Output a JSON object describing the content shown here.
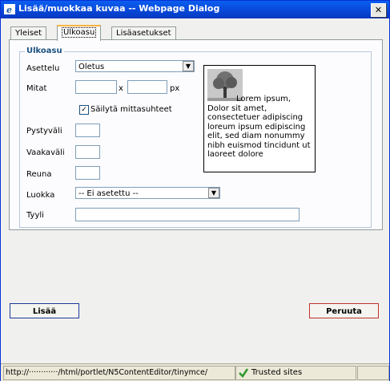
{
  "titlebar": {
    "title": "Lisää/muokkaa kuvaa -- Webpage Dialog",
    "close_glyph": "✕"
  },
  "tabs": [
    {
      "label": "Yleiset",
      "active": false
    },
    {
      "label": "Ulkoasu",
      "active": true
    },
    {
      "label": "Lisäasetukset",
      "active": false
    }
  ],
  "fieldset": {
    "legend": "Ulkoasu",
    "align_label": "Asettelu",
    "align_value": "Oletus",
    "dims_label": "Mitat",
    "width_value": "",
    "x_sep": "x",
    "height_value": "",
    "unit": "px",
    "keep_ratio_label": "Säilytä mittasuhteet",
    "keep_ratio_checked": "✓",
    "vspace_label": "Pystyväli",
    "vspace_value": "",
    "hspace_label": "Vaakaväli",
    "hspace_value": "",
    "border_label": "Reuna",
    "border_value": "",
    "class_label": "Luokka",
    "class_value": "-- Ei asetettu --",
    "style_label": "Tyyli",
    "style_value": ""
  },
  "preview": {
    "text": "Lorem ipsum, Dolor sit amet, consectetuer adipiscing loreum ipsum edipiscing elit, sed diam nonummy nibh euismod tincidunt ut laoreet dolore"
  },
  "buttons": {
    "insert": "Lisää",
    "cancel": "Peruuta"
  },
  "statusbar": {
    "url": "http://············/html/portlet/N5ContentEditor/tinymce/",
    "zone": "Trusted sites"
  },
  "colors": {
    "title_bar": "#0846d6",
    "legend": "#1c5180",
    "tab_highlight": "#f9b43c"
  }
}
